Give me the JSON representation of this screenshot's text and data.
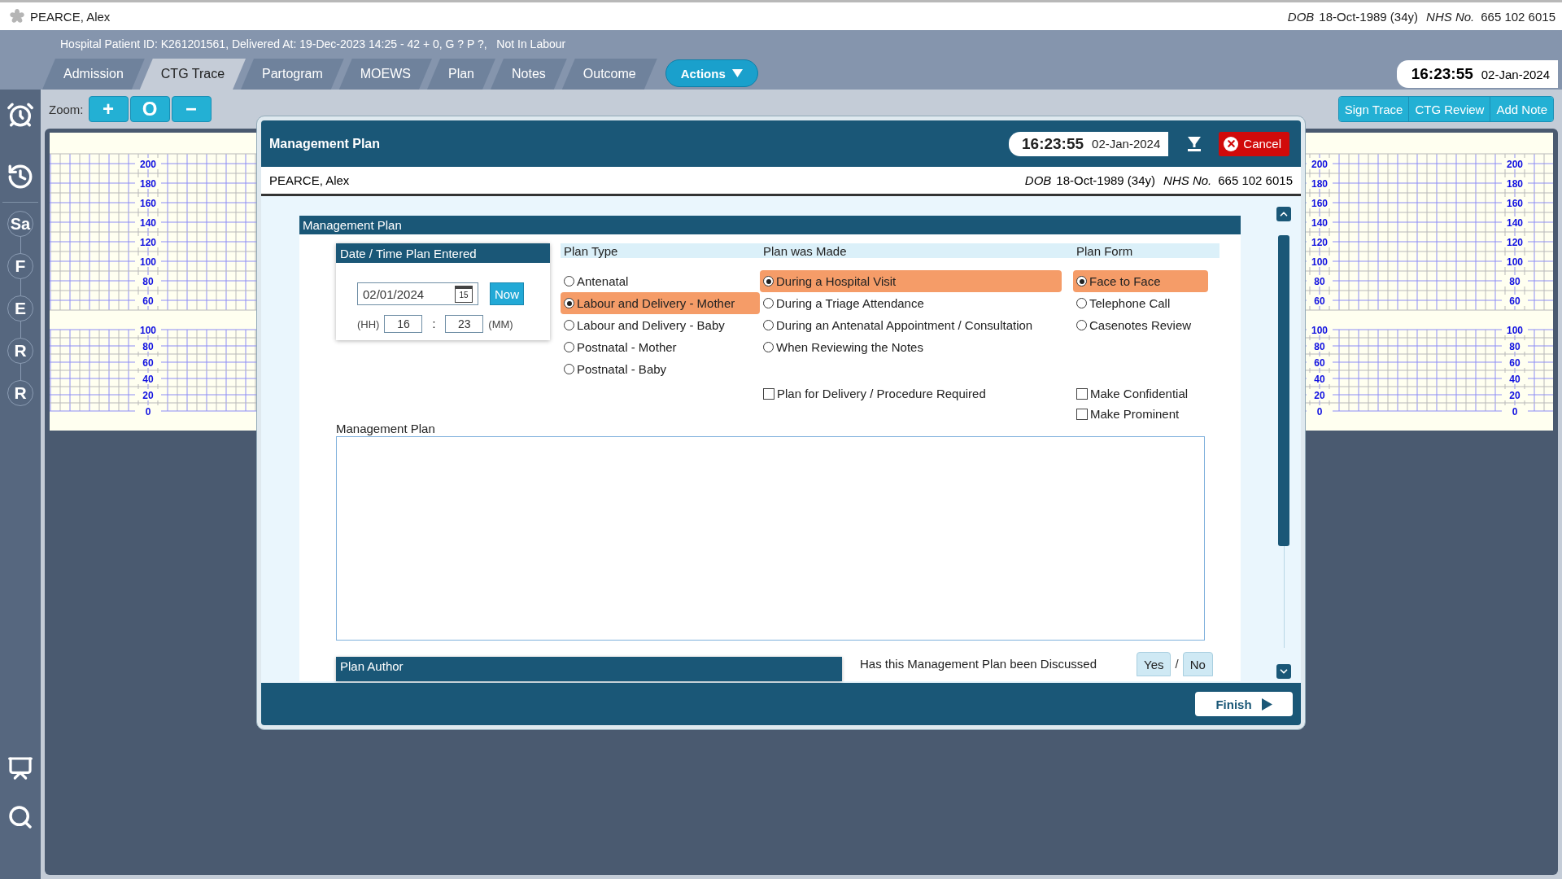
{
  "header": {
    "patient_name": "PEARCE, Alex",
    "dob_label": "DOB",
    "dob": "18-Oct-1989 (34y)",
    "nhs_label": "NHS No.",
    "nhs": "665 102 6015"
  },
  "patient_info": "Hospital Patient ID: K261201561, Delivered At: 19-Dec-2023 14:25 - 42 + 0, G ? P ?,   Not In Labour",
  "tabs": [
    {
      "label": "Admission",
      "selected": false
    },
    {
      "label": "CTG Trace",
      "selected": true
    },
    {
      "label": "Partogram",
      "selected": false
    },
    {
      "label": "MOEWS",
      "selected": false
    },
    {
      "label": "Plan",
      "selected": false
    },
    {
      "label": "Notes",
      "selected": false
    },
    {
      "label": "Outcome",
      "selected": false
    }
  ],
  "actions_button": "Actions",
  "clock": {
    "time": "16:23:55",
    "date": "02-Jan-2024"
  },
  "sidebar": {
    "badges": [
      "Sa",
      "F",
      "E",
      "R",
      "R"
    ]
  },
  "zoom": {
    "label": "Zoom:",
    "buttons": [
      "+",
      "O",
      "−"
    ]
  },
  "trace_buttons": [
    "Sign Trace",
    "CTG Review",
    "Add Note"
  ],
  "ctg": {
    "axes": [
      {
        "fhr_ticks": [
          "200",
          "180",
          "160",
          "140",
          "120",
          "100",
          "80",
          "60"
        ],
        "toco_ticks": [
          "100",
          "80",
          "60",
          "40",
          "20",
          "0"
        ]
      },
      {
        "fhr_ticks": [
          "200",
          "180",
          "160",
          "140",
          "120",
          "100",
          "80",
          "60"
        ],
        "toco_ticks": [
          "100",
          "80",
          "60",
          "40",
          "20",
          "0"
        ]
      },
      {
        "fhr_ticks": [
          "200",
          "180",
          "160",
          "140",
          "120",
          "100",
          "80",
          "60"
        ],
        "toco_ticks": [
          "100",
          "80",
          "60",
          "40",
          "20",
          "0"
        ]
      }
    ]
  },
  "dialog": {
    "title": "Management Plan",
    "clock": {
      "time": "16:23:55",
      "date": "02-Jan-2024"
    },
    "cancel": "Cancel",
    "patient": {
      "name": "PEARCE, Alex",
      "dob_label": "DOB",
      "dob": "18-Oct-1989 (34y)",
      "nhs_label": "NHS No.",
      "nhs": "665 102 6015"
    },
    "section_title": "Management Plan",
    "datetime": {
      "title": "Date / Time Plan Entered",
      "date": "02/01/2024",
      "calendar_day": "15",
      "now": "Now",
      "hh_label": "(HH)",
      "hour": "16",
      "separator": ":",
      "minute": "23",
      "mm_label": "(MM)"
    },
    "option_groups": [
      {
        "title": "Plan Type",
        "options": [
          {
            "label": "Antenatal",
            "selected": false
          },
          {
            "label": "Labour and Delivery - Mother",
            "selected": true
          },
          {
            "label": "Labour and Delivery - Baby",
            "selected": false
          },
          {
            "label": "Postnatal - Mother",
            "selected": false
          },
          {
            "label": "Postnatal - Baby",
            "selected": false
          }
        ]
      },
      {
        "title": "Plan was Made",
        "options": [
          {
            "label": "During a Hospital Visit",
            "selected": true
          },
          {
            "label": "During a Triage Attendance",
            "selected": false
          },
          {
            "label": "During an Antenatal Appointment / Consultation",
            "selected": false
          },
          {
            "label": "When Reviewing the Notes",
            "selected": false
          }
        ],
        "checkboxes": [
          {
            "label": "Plan for Delivery / Procedure Required",
            "checked": false
          }
        ]
      },
      {
        "title": "Plan Form",
        "options": [
          {
            "label": "Face to Face",
            "selected": true
          },
          {
            "label": "Telephone Call",
            "selected": false
          },
          {
            "label": "Casenotes Review",
            "selected": false
          }
        ],
        "checkboxes": [
          {
            "label": "Make Confidential",
            "checked": false
          },
          {
            "label": "Make Prominent",
            "checked": false
          }
        ]
      }
    ],
    "notes_label": "Management Plan",
    "author_title": "Plan Author",
    "question": "Has this Management Plan been Discussed",
    "answers": [
      {
        "label": "Yes",
        "selected": false
      },
      {
        "label": "No",
        "selected": false
      }
    ],
    "answer_separator": "/",
    "finish": "Finish"
  }
}
